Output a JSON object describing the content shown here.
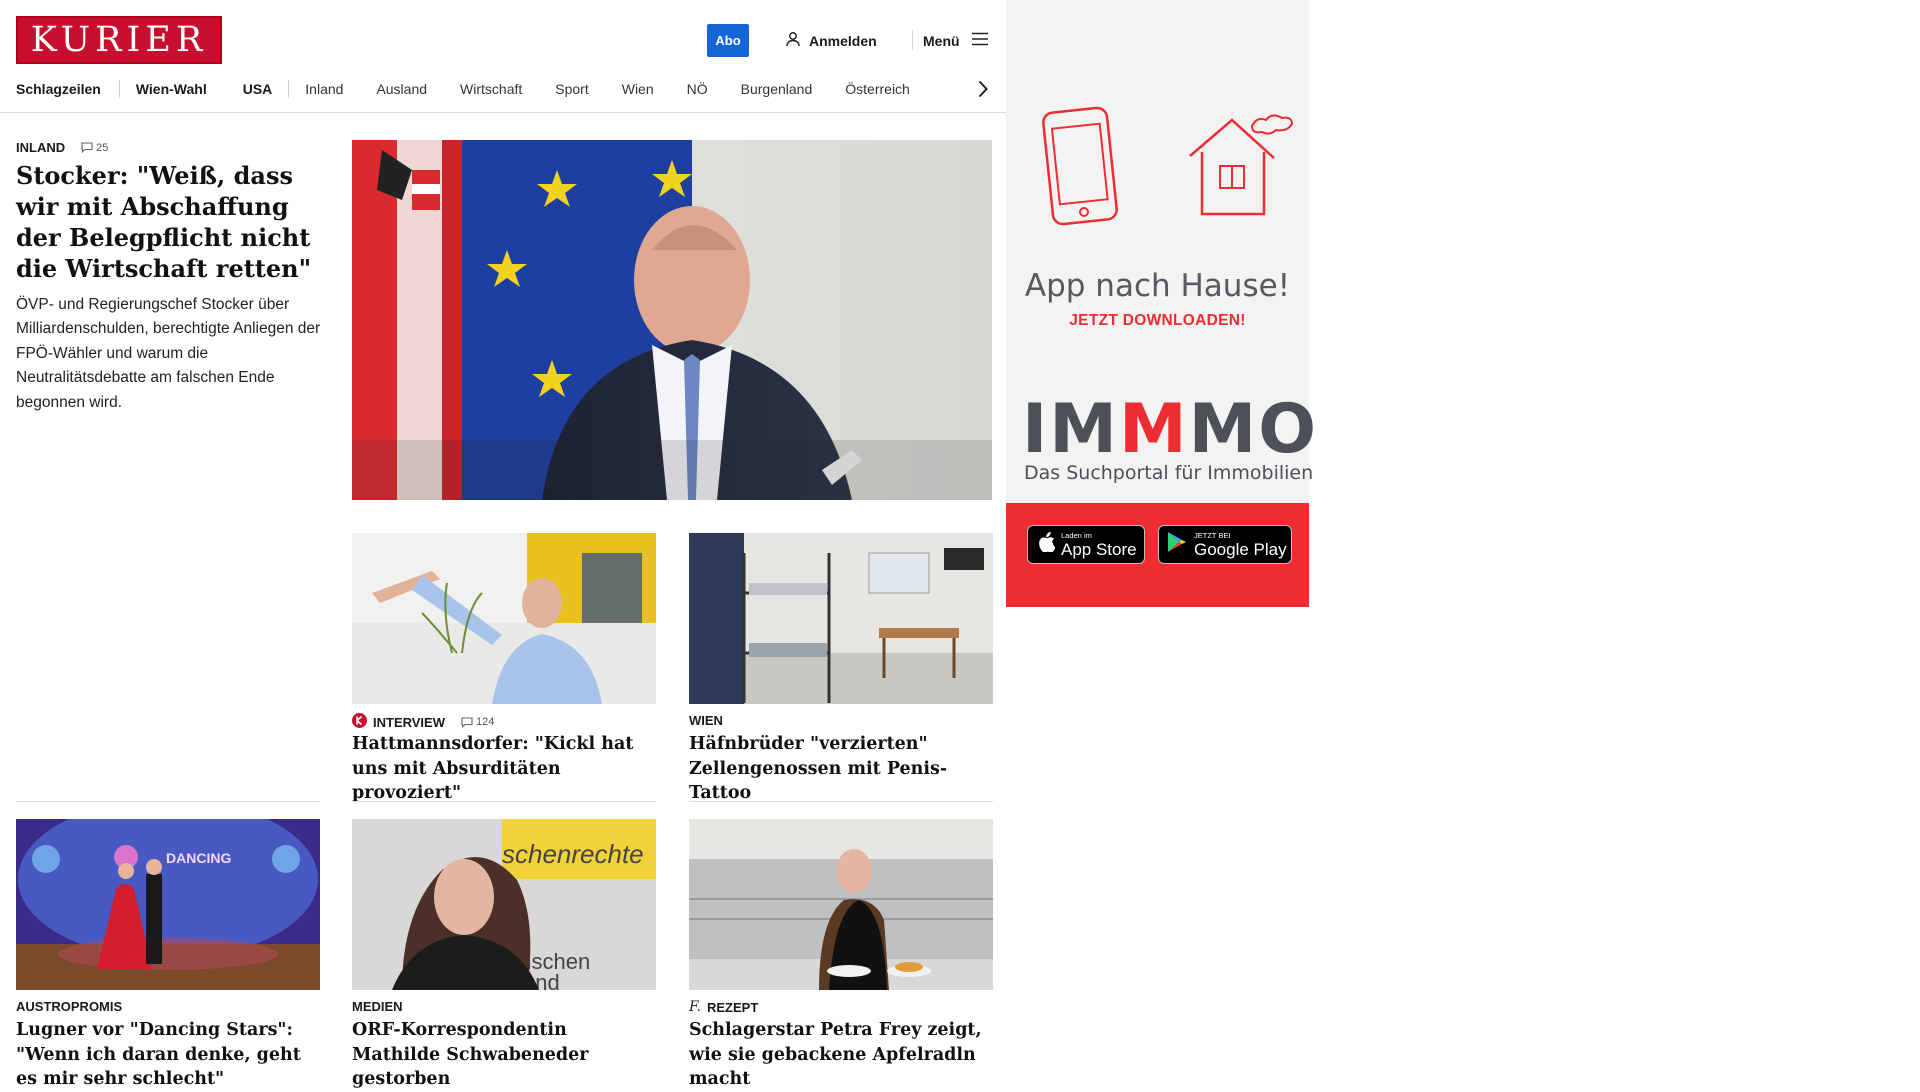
{
  "header": {
    "logo": "KURIER",
    "abo": "Abo",
    "login": "Anmelden",
    "menu": "Menü"
  },
  "nav": {
    "items": [
      "Schlagzeilen",
      "Wien-Wahl",
      "USA",
      "Inland",
      "Ausland",
      "Wirtschaft",
      "Sport",
      "Wien",
      "NÖ",
      "Burgenland",
      "Österreich"
    ]
  },
  "lead": {
    "category": "INLAND",
    "comments": "25",
    "title": "Stocker: \"Weiß, dass wir mit Abschaffung der Belegpflicht nicht die Wirtschaft retten\"",
    "teaser": "ÖVP- und Regierungschef Stocker über Milliardenschulden, berechtigte Anliegen der FPÖ-Wähler und warum die Neutralitätsdebatte am falschen Ende begonnen wird."
  },
  "articles": [
    {
      "category": "INTERVIEW",
      "comments": "124",
      "title": "Hattmannsdorfer: \"Kickl hat uns mit Absurditäten provoziert\""
    },
    {
      "category": "WIEN",
      "title": "Häfnbrüder \"verzierten\" Zellengenossen mit Penis-Tattoo"
    },
    {
      "category": "AUSTROPROMIS",
      "title": "Lugner vor \"Dancing Stars\": \"Wenn ich daran denke, geht es mir sehr schlecht\""
    },
    {
      "category": "MEDIEN",
      "title": "ORF-Korrespondentin Mathilde Schwabeneder gestorben"
    },
    {
      "category": "REZEPT",
      "title": "Schlagerstar Petra Frey zeigt, wie sie gebackene Apfelradln macht"
    }
  ],
  "ad": {
    "headline": "App nach Hause!",
    "cta": "JETZT DOWNLOADEN!",
    "brand_1": "IM",
    "brand_2": "M",
    "brand_3": "MO",
    "brand_sub": "Das Suchportal für Immobilien",
    "appstore_small": "Laden im",
    "appstore_big": "App Store",
    "googleplay_small": "JETZT BEI",
    "googleplay_big": "Google Play"
  },
  "image_text": {
    "dancing_logo": "DANCING",
    "poster_text_1": "schenrechte",
    "poster_text_2": "enschen",
    "poster_text_3": "i und"
  },
  "colors": {
    "brand_red": "#c8102e",
    "abo_blue": "#1565d8",
    "ad_red": "#ee2d32",
    "ad_grey": "#f3f3f3"
  }
}
